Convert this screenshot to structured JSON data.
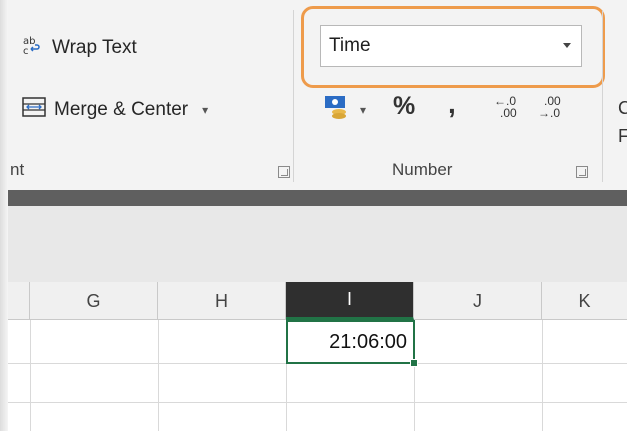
{
  "ribbon": {
    "alignment": {
      "wrap_text_label": "Wrap Text",
      "merge_center_label": "Merge & Center",
      "group_label_partial": "nt"
    },
    "number": {
      "format_value": "Time",
      "group_label": "Number",
      "percent_symbol": "%",
      "comma_symbol": ",",
      "increase_decimal_top": "←.0",
      "increase_decimal_bottom": ".00",
      "decrease_decimal_top": ".00",
      "decrease_decimal_bottom": "→.0"
    },
    "styles": {
      "conditional_formatting_partial_1": "C",
      "conditional_formatting_partial_2": "Fo"
    }
  },
  "sheet": {
    "columns": [
      "G",
      "H",
      "I",
      "J",
      "K"
    ],
    "selected_column": "I",
    "active_cell_value": "21:06:00"
  },
  "colors": {
    "accent_highlight": "#ee9b4b",
    "excel_green": "#217346",
    "selected_header_bg": "#2f2f2f"
  },
  "icons": [
    "wrap-text-icon",
    "merge-center-icon",
    "currency-icon",
    "chevron-down-icon",
    "dialog-launcher-icon"
  ]
}
